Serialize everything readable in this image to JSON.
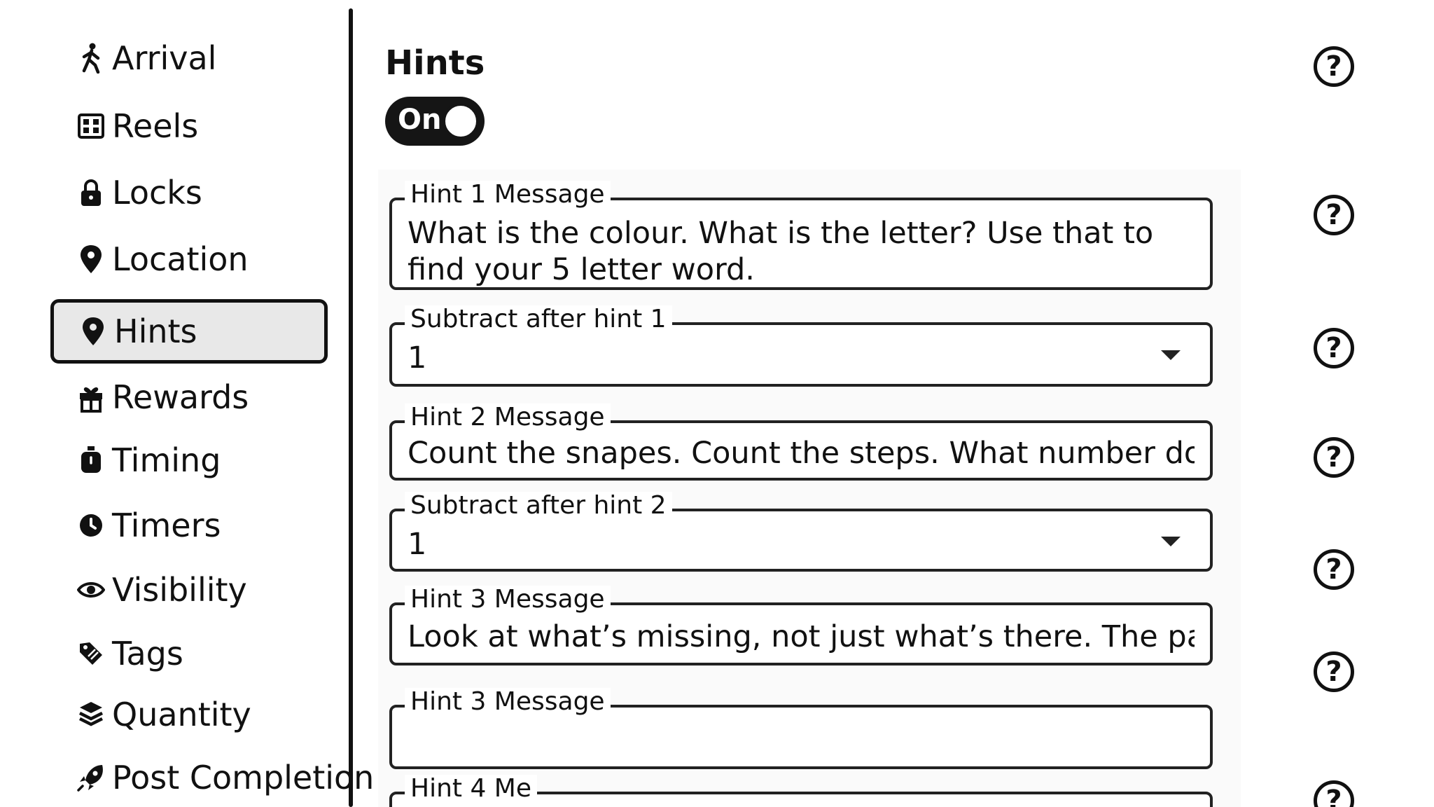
{
  "sidebar": {
    "items": [
      {
        "label": "Arrival",
        "icon": "walking-person-icon"
      },
      {
        "label": "Reels",
        "icon": "film-reel-icon"
      },
      {
        "label": "Locks",
        "icon": "padlock-icon"
      },
      {
        "label": "Location",
        "icon": "map-pin-icon"
      },
      {
        "label": "Hints",
        "icon": "map-pin-icon",
        "active": true
      },
      {
        "label": "Rewards",
        "icon": "gift-icon"
      },
      {
        "label": "Timing",
        "icon": "stopwatch-icon"
      },
      {
        "label": "Timers",
        "icon": "timer-icon"
      },
      {
        "label": "Visibility",
        "icon": "eye-icon"
      },
      {
        "label": "Tags",
        "icon": "tag-icon"
      },
      {
        "label": "Quantity",
        "icon": "stack-icon"
      },
      {
        "label": "Post Completion",
        "icon": "rocket-icon"
      }
    ]
  },
  "main": {
    "title": "Hints",
    "toggle": {
      "label": "On",
      "state": "on"
    },
    "fields": [
      {
        "legend": "Hint 1 Message",
        "value": "What is the colour. What is the letter? Use that to find your 5 letter word."
      },
      {
        "legend": "Subtract after hint 1",
        "value": "1"
      },
      {
        "legend": "Hint 2 Message",
        "value": "Count the snapes. Count the steps. What number do you g"
      },
      {
        "legend": "Subtract after hint 2",
        "value": "1"
      },
      {
        "legend": "Hint 3 Message",
        "value": "Look at what’s missing, not just what’s there. The patt("
      },
      {
        "legend": "Hint 3 Message",
        "value": ""
      },
      {
        "legend": "Hint 4 Me",
        "value": ""
      }
    ],
    "help_icon_glyph": "?"
  },
  "colors": {
    "ink": "#111111",
    "active_nav_bg": "#e8e8e8",
    "toggle_bg": "#151515",
    "panel_bg": "#fafafa"
  }
}
